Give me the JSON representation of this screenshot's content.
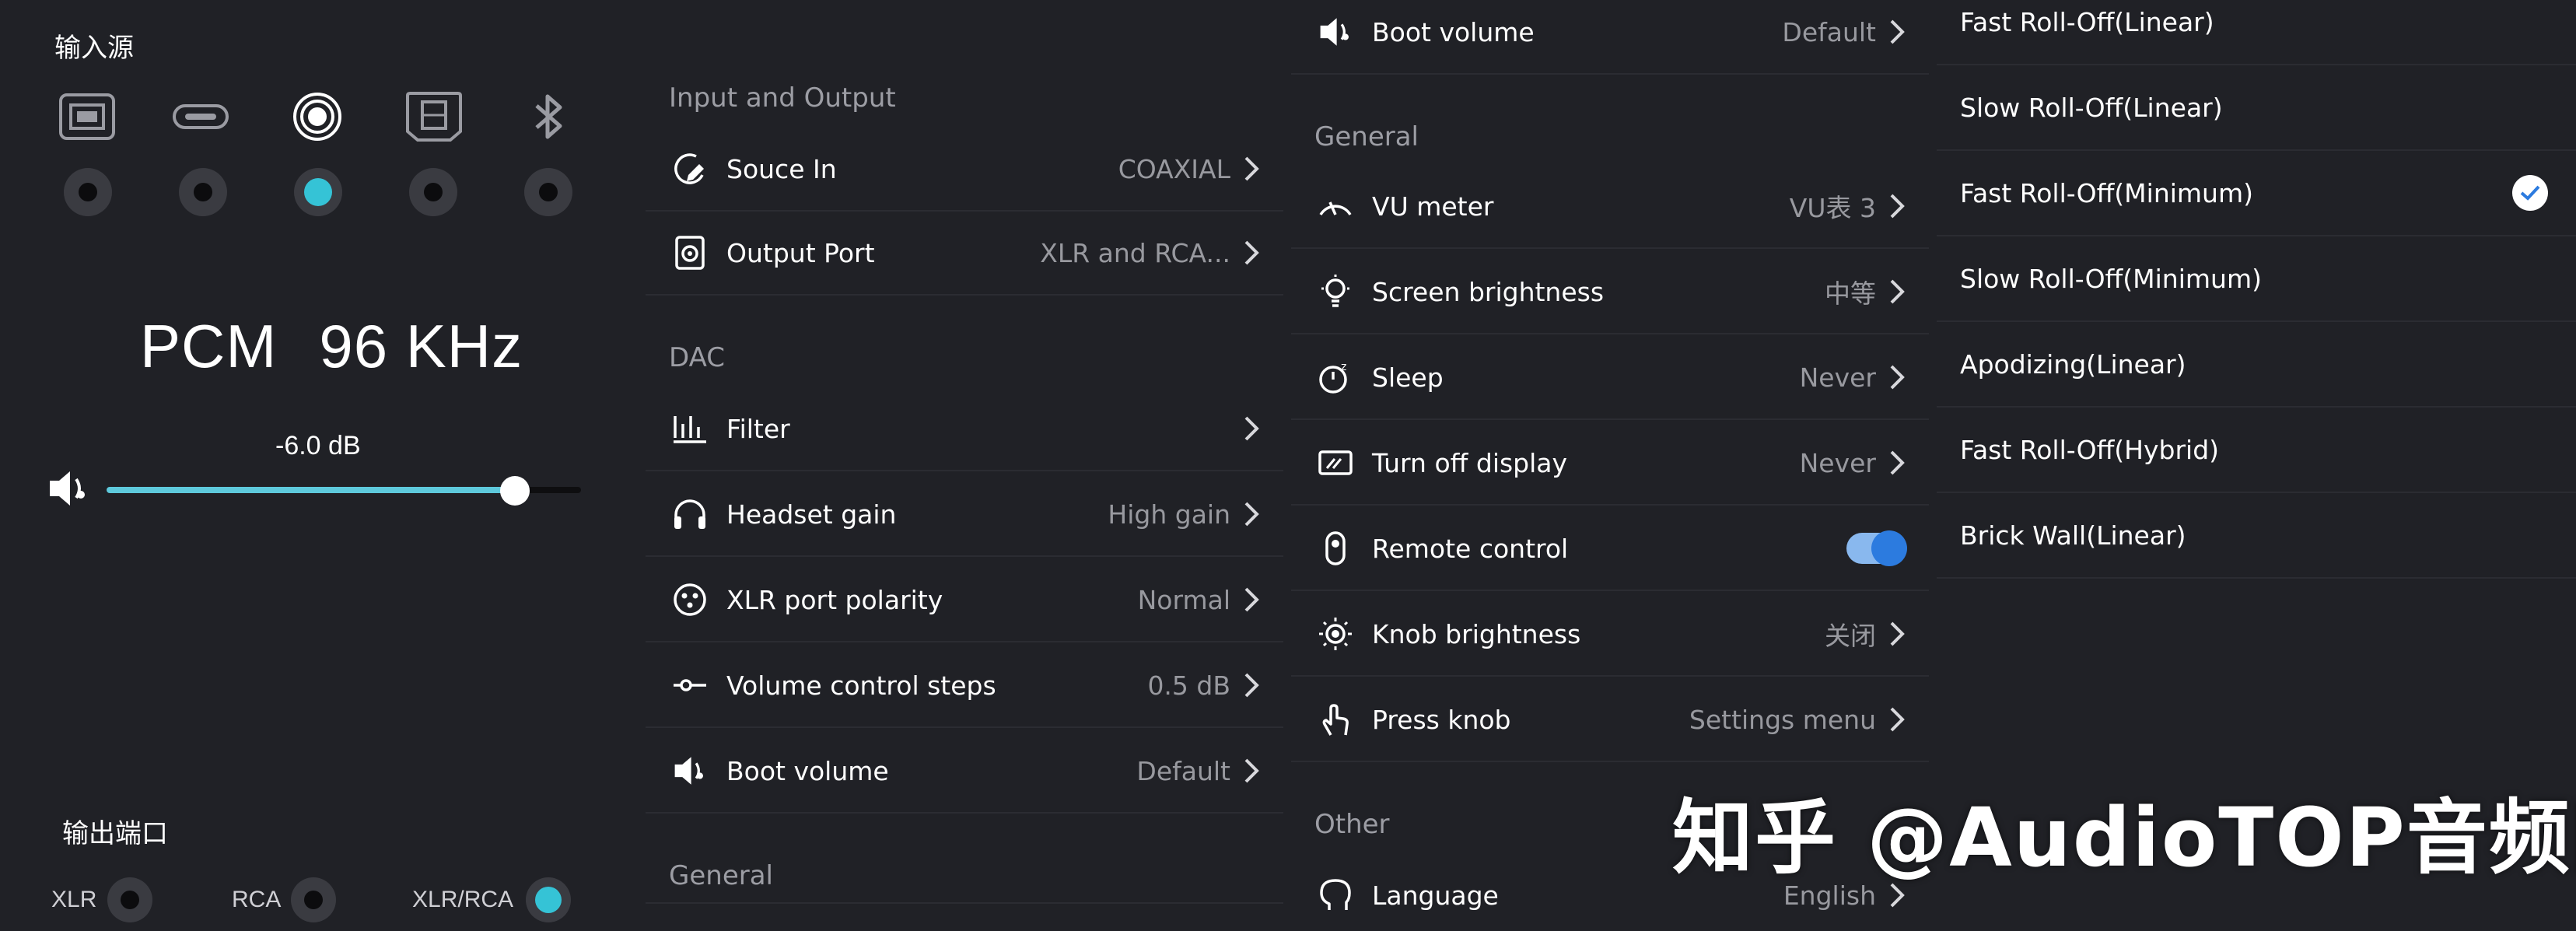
{
  "panel1": {
    "input_title": "输入源",
    "sources": [
      {
        "icon": "usb-b-icon",
        "active": false
      },
      {
        "icon": "usb-c-icon",
        "active": false
      },
      {
        "icon": "coaxial-icon",
        "active": true
      },
      {
        "icon": "optical-icon",
        "active": false
      },
      {
        "icon": "bluetooth-icon",
        "active": false
      }
    ],
    "format": "PCM",
    "sample_rate": "96 KHz",
    "volume_db": "-6.0 dB",
    "volume_level": 0.86,
    "output_title": "输出端口",
    "outputs": [
      {
        "label": "XLR",
        "active": false
      },
      {
        "label": "RCA",
        "active": false
      },
      {
        "label": "XLR/RCA",
        "active": true
      }
    ]
  },
  "panel2": {
    "sections": [
      {
        "title": "Input and Output",
        "rows": [
          {
            "icon": "source-in-icon",
            "label": "Souce In",
            "value": "COAXIAL"
          },
          {
            "icon": "output-port-icon",
            "label": "Output Port",
            "value": "XLR and RCA..."
          }
        ]
      },
      {
        "title": "DAC",
        "rows": [
          {
            "icon": "filter-icon",
            "label": "Filter",
            "value": ""
          },
          {
            "icon": "headphones-icon",
            "label": "Headset gain",
            "value": "High gain"
          },
          {
            "icon": "xlr-polarity-icon",
            "label": "XLR port polarity",
            "value": "Normal"
          },
          {
            "icon": "volume-steps-icon",
            "label": "Volume control steps",
            "value": "0.5 dB"
          },
          {
            "icon": "speaker-icon",
            "label": "Boot volume",
            "value": "Default"
          }
        ]
      },
      {
        "title": "General",
        "rows": []
      }
    ]
  },
  "panel3": {
    "top_row": {
      "icon": "speaker-icon",
      "label": "Boot volume",
      "value": "Default"
    },
    "sections": [
      {
        "title": "General",
        "rows": [
          {
            "icon": "vu-meter-icon",
            "label": "VU meter",
            "value": "VU表 3"
          },
          {
            "icon": "brightness-bulb-icon",
            "label": "Screen brightness",
            "value": "中等"
          },
          {
            "icon": "sleep-timer-icon",
            "label": "Sleep",
            "value": "Never"
          },
          {
            "icon": "display-off-icon",
            "label": "Turn off display",
            "value": "Never"
          },
          {
            "icon": "remote-icon",
            "label": "Remote control",
            "toggle": true
          },
          {
            "icon": "knob-brightness-icon",
            "label": "Knob brightness",
            "value": "关闭"
          },
          {
            "icon": "press-knob-icon",
            "label": "Press knob",
            "value": "Settings menu"
          }
        ]
      },
      {
        "title": "Other",
        "rows": [
          {
            "icon": "language-icon",
            "label": "Language",
            "value": "English"
          }
        ]
      }
    ]
  },
  "panel4": {
    "filters": [
      {
        "label": "Fast Roll-Off(Linear)",
        "selected": false
      },
      {
        "label": "Slow Roll-Off(Linear)",
        "selected": false
      },
      {
        "label": "Fast Roll-Off(Minimum)",
        "selected": true
      },
      {
        "label": "Slow Roll-Off(Minimum)",
        "selected": false
      },
      {
        "label": "Apodizing(Linear)",
        "selected": false
      },
      {
        "label": "Fast Roll-Off(Hybrid)",
        "selected": false
      },
      {
        "label": "Brick Wall(Linear)",
        "selected": false
      }
    ]
  },
  "watermark": "知乎 @AudioTOP音频网",
  "colors": {
    "background": "#202126",
    "accent": "#35c3d6",
    "toggle": "#2c7bdf",
    "value_text": "#98999f"
  }
}
